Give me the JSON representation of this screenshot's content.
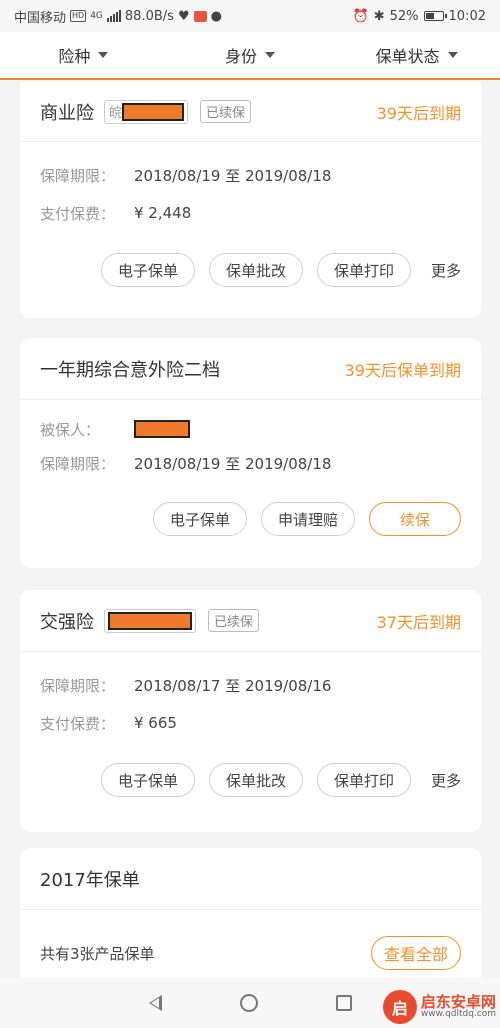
{
  "status_bar": {
    "carrier": "中国移动",
    "hd": "HD",
    "net_type": "4G",
    "speed": "88.0B/s",
    "battery_percent": "52%",
    "battery_level": 0.52,
    "time": "10:02",
    "icons": [
      "hd-icon",
      "signal-icon",
      "heart-icon",
      "app-icon",
      "chat-icon",
      "alarm-icon",
      "bluetooth-icon",
      "battery-icon"
    ]
  },
  "filters": [
    {
      "label": "险种"
    },
    {
      "label": "身份"
    },
    {
      "label": "保单状态"
    }
  ],
  "cards": [
    {
      "title": "商业险",
      "plate_prefix": "皖",
      "renewed": "已续保",
      "due": "39天后到期",
      "rows": [
        {
          "key": "保障期限：",
          "value": "2018/08/19 至 2019/08/18"
        },
        {
          "key": "支付保费：",
          "value": "¥ 2,448"
        }
      ],
      "actions": [
        "电子保单",
        "保单批改",
        "保单打印"
      ],
      "more": "更多"
    },
    {
      "title": "一年期综合意外险二档",
      "due": "39天后保单到期",
      "rows": [
        {
          "key": "被保人：",
          "value": ""
        },
        {
          "key": "保障期限：",
          "value": "2018/08/19 至 2019/08/18"
        }
      ],
      "actions": [
        "电子保单",
        "申请理赔"
      ],
      "primary_action": "续保"
    },
    {
      "title": "交强险",
      "renewed": "已续保",
      "due": "37天后到期",
      "rows": [
        {
          "key": "保障期限：",
          "value": "2018/08/17 至 2019/08/16"
        },
        {
          "key": "支付保费：",
          "value": "¥ 665"
        }
      ],
      "actions": [
        "电子保单",
        "保单批改",
        "保单打印"
      ],
      "more": "更多"
    },
    {
      "title": "2017年保单",
      "summary": "共有3张产品保单",
      "view_all": "查看全部"
    }
  ],
  "watermark": {
    "logo_char": "启",
    "name": "启东安卓网",
    "url": "www.qdltdq.com"
  },
  "colors": {
    "accent": "#f0922e",
    "redaction": "#f07a2c"
  }
}
